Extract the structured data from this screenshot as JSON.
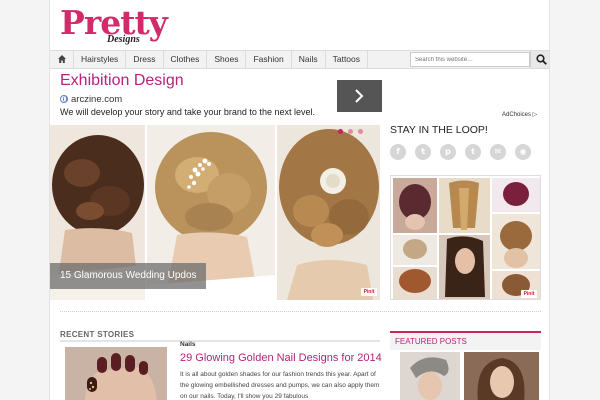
{
  "header": {
    "logo_main": "Pretty",
    "logo_sub": "Designs",
    "brand_color": "#d22a6a"
  },
  "nav": {
    "home_icon": "home-icon",
    "items": [
      "Hairstyles",
      "Dress",
      "Clothes",
      "Shoes",
      "Fashion",
      "Nails",
      "Tattoos"
    ],
    "search_placeholder": "Search this website…",
    "search_icon": "magnifier-icon"
  },
  "ad": {
    "title": "Exhibition Design",
    "domain": "arczine.com",
    "description": "We will develop your story and take your brand to the next level.",
    "arrow_icon": "chevron-right-icon",
    "adchoices_label": "AdChoices",
    "title_color": "#b4237a"
  },
  "hero": {
    "caption": "15 Glamorous Wedding Updos",
    "pin_label": "Pinit",
    "active_slide": 1,
    "slide_count": 3
  },
  "sidebar": {
    "stay_heading": "STAY IN THE LOOP!",
    "social_icons": [
      {
        "name": "facebook-icon",
        "glyph": "f"
      },
      {
        "name": "twitter-icon",
        "glyph": "t"
      },
      {
        "name": "pinterest-icon",
        "glyph": "p"
      },
      {
        "name": "tumblr-icon",
        "glyph": "t"
      },
      {
        "name": "email-icon",
        "glyph": "✉"
      },
      {
        "name": "rss-icon",
        "glyph": "◉"
      }
    ],
    "collage_pin_label": "Pinit"
  },
  "recent": {
    "heading": "RECENT STORIES",
    "story": {
      "category": "Nails",
      "title": "29 Glowing Golden Nail Designs for 2014",
      "excerpt": "It is all about golden shades for our fashion trends this year. Apart of the glowing embellished dresses and pumps, we can also apply them on our nails. Today, I'll show you 29 fabulous"
    }
  },
  "featured": {
    "heading": "FEATURED POSTS",
    "accent_color": "#c8235f"
  }
}
